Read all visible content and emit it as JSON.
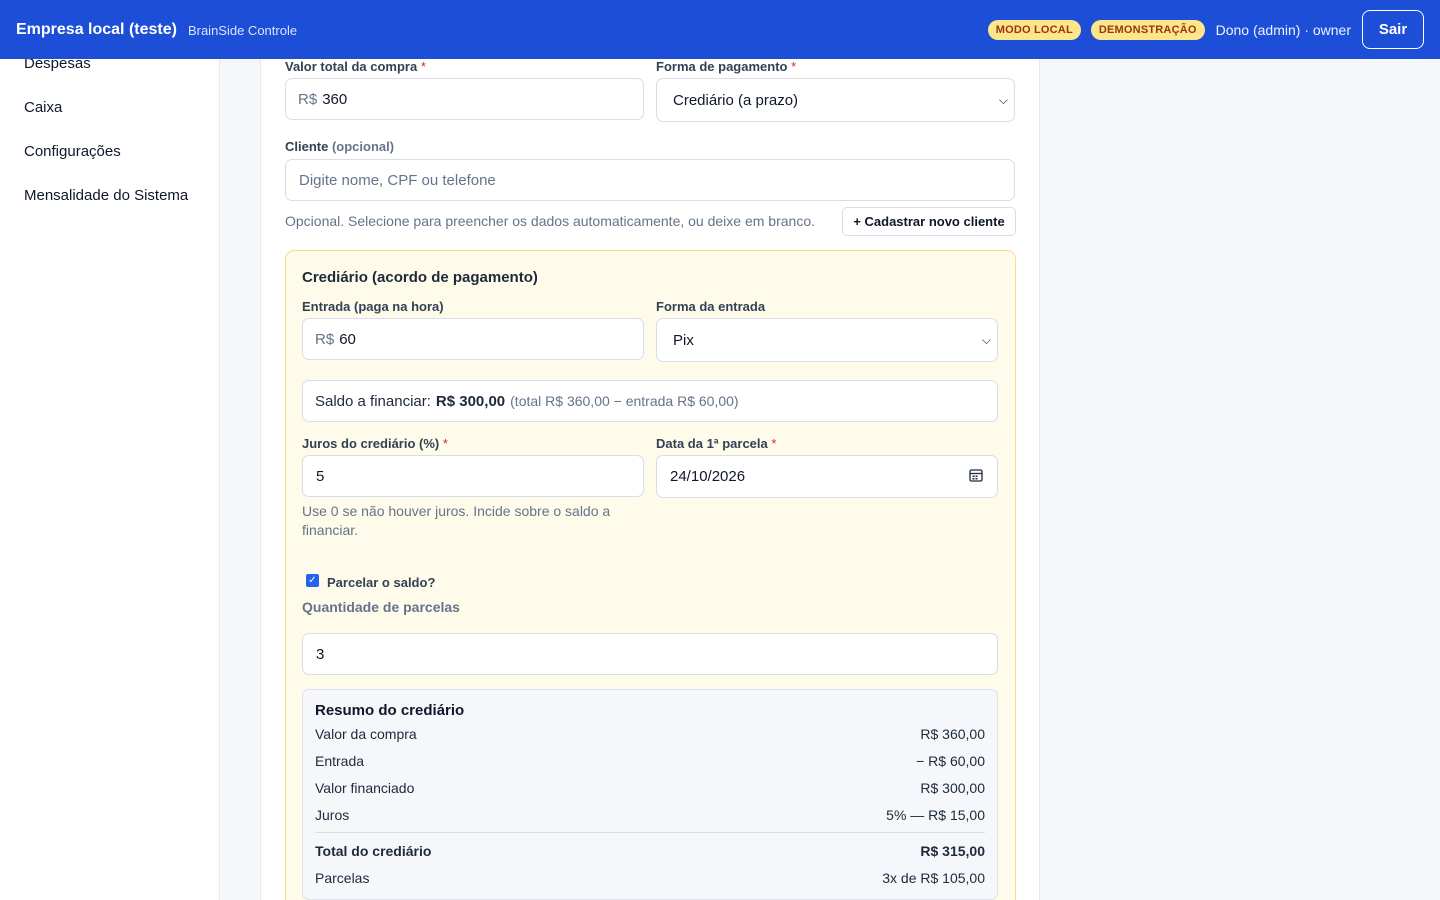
{
  "header": {
    "company": "Empresa local (teste)",
    "product": "BrainSide Controle",
    "badge_local": "MODO LOCAL",
    "badge_demo": "DEMONSTRAÇÃO",
    "user": "Dono (admin) · owner",
    "logout": "Sair"
  },
  "sidebar": {
    "items": [
      {
        "label": "Despesas"
      },
      {
        "label": "Caixa"
      },
      {
        "label": "Configurações"
      },
      {
        "label": "Mensalidade do Sistema"
      }
    ]
  },
  "form": {
    "total_label": "Valor total da compra",
    "total_prefix": "R$",
    "total_value": "360",
    "payment_label": "Forma de pagamento",
    "payment_value": "Crediário (a prazo)",
    "client_label": "Cliente",
    "client_optional": "(opcional)",
    "client_placeholder": "Digite nome, CPF ou telefone",
    "client_help": "Opcional. Selecione para preencher os dados automaticamente, ou deixe em branco.",
    "new_client_button": "+ Cadastrar novo cliente",
    "required_mark": "*"
  },
  "credit": {
    "title": "Crediário (acordo de pagamento)",
    "entry_label": "Entrada (paga na hora)",
    "entry_prefix": "R$",
    "entry_value": "60",
    "entry_method_label": "Forma da entrada",
    "entry_method_value": "Pix",
    "saldo_prefix": "Saldo a financiar:",
    "saldo_value": "R$ 300,00",
    "saldo_note": "(total R$ 360,00 − entrada R$ 60,00)",
    "interest_label": "Juros do crediário (%)",
    "interest_value": "5",
    "interest_help": "Use 0 se não houver juros. Incide sobre o saldo a financiar.",
    "first_date_label": "Data da 1ª parcela",
    "first_date_value": "24/10/2026",
    "installments_checkbox": "Parcelar o saldo?",
    "installments_checked": true,
    "installments_qty_label": "Quantidade de parcelas",
    "installments_qty": "3"
  },
  "summary": {
    "title": "Resumo do crediário",
    "rows": [
      {
        "label": "Valor da compra",
        "value": "R$ 360,00"
      },
      {
        "label": "Entrada",
        "value": "− R$ 60,00"
      },
      {
        "label": "Valor financiado",
        "value": "R$ 300,00"
      },
      {
        "label": "Juros",
        "value": "5% — R$ 15,00"
      },
      {
        "label": "Total do crediário",
        "value": "R$ 315,00"
      },
      {
        "label": "Parcelas",
        "value": "3x de R$ 105,00"
      }
    ]
  }
}
